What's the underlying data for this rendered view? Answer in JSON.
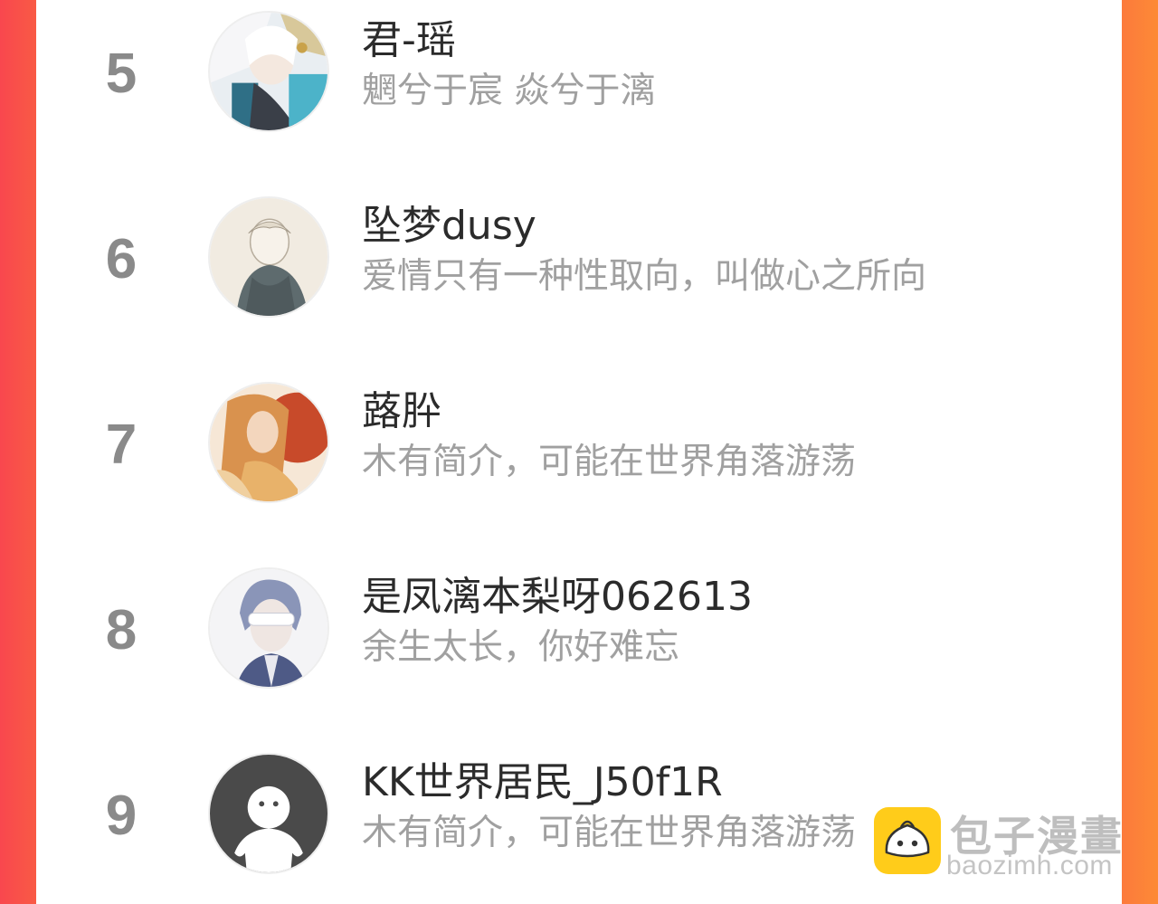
{
  "ranking": [
    {
      "rank": "5",
      "name": "君-瑶",
      "bio": "魍兮于宸 焱兮于漓",
      "avatar": "anime-avatar-white-hair"
    },
    {
      "rank": "6",
      "name": "坠梦dusy",
      "bio": "爱情只有一种性取向，叫做心之所向",
      "avatar": "anime-avatar-sketch"
    },
    {
      "rank": "7",
      "name": "蕗肸",
      "bio": "木有简介，可能在世界角落游荡",
      "avatar": "anime-avatar-orange"
    },
    {
      "rank": "8",
      "name": "是凤漓本梨呀062613",
      "bio": "余生太长，你好难忘",
      "avatar": "anime-avatar-blindfold"
    },
    {
      "rank": "9",
      "name": "KK世界居民_J50f1R",
      "bio": "木有简介，可能在世界角落游荡",
      "avatar": "default-avatar-icon"
    }
  ],
  "watermark": {
    "title": "包子漫畫",
    "url": "baozimh.com",
    "logo": "bun-logo-icon"
  },
  "colors": {
    "left_border": "#f9474e",
    "right_border": "#fd8a36",
    "rank_text": "#8a8a8a",
    "name_text": "#2b2b2b",
    "bio_text": "#a0a0a0"
  }
}
